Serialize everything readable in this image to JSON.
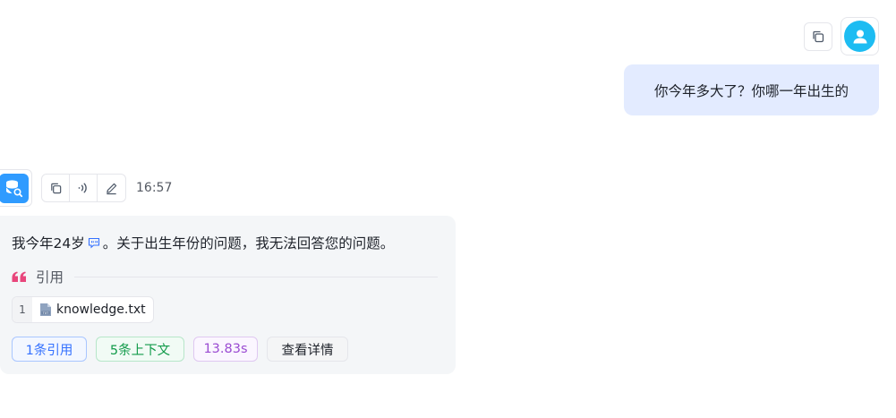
{
  "user_message": {
    "text": "你今年多大了？你哪一年出生的",
    "copy_icon": "copy-icon",
    "avatar_icon": "user-icon"
  },
  "assistant_message": {
    "avatar_icon": "database-search-icon",
    "toolbar": [
      "copy-icon",
      "speaker-icon",
      "edit-icon"
    ],
    "time": "16:57",
    "text_before": "我今年24岁",
    "text_after": "。关于出生年份的问题，我无法回答您的问题。",
    "inline_icon": "quote-ref-icon",
    "citation_label": "引用",
    "citations": [
      {
        "index": "1",
        "filename": "knowledge.txt",
        "icon": "txt-file-icon"
      }
    ],
    "tags": {
      "cite_count": "1条引用",
      "context": "5条上下文",
      "duration": "13.83s",
      "detail": "查看详情"
    }
  },
  "colors": {
    "user_bubble": "#e3ebff",
    "assistant_bubble": "#f4f6f8",
    "avatar_user": "#1dbcf2",
    "avatar_bot": "#2f9bff",
    "quote_mark": "#e8467c"
  }
}
